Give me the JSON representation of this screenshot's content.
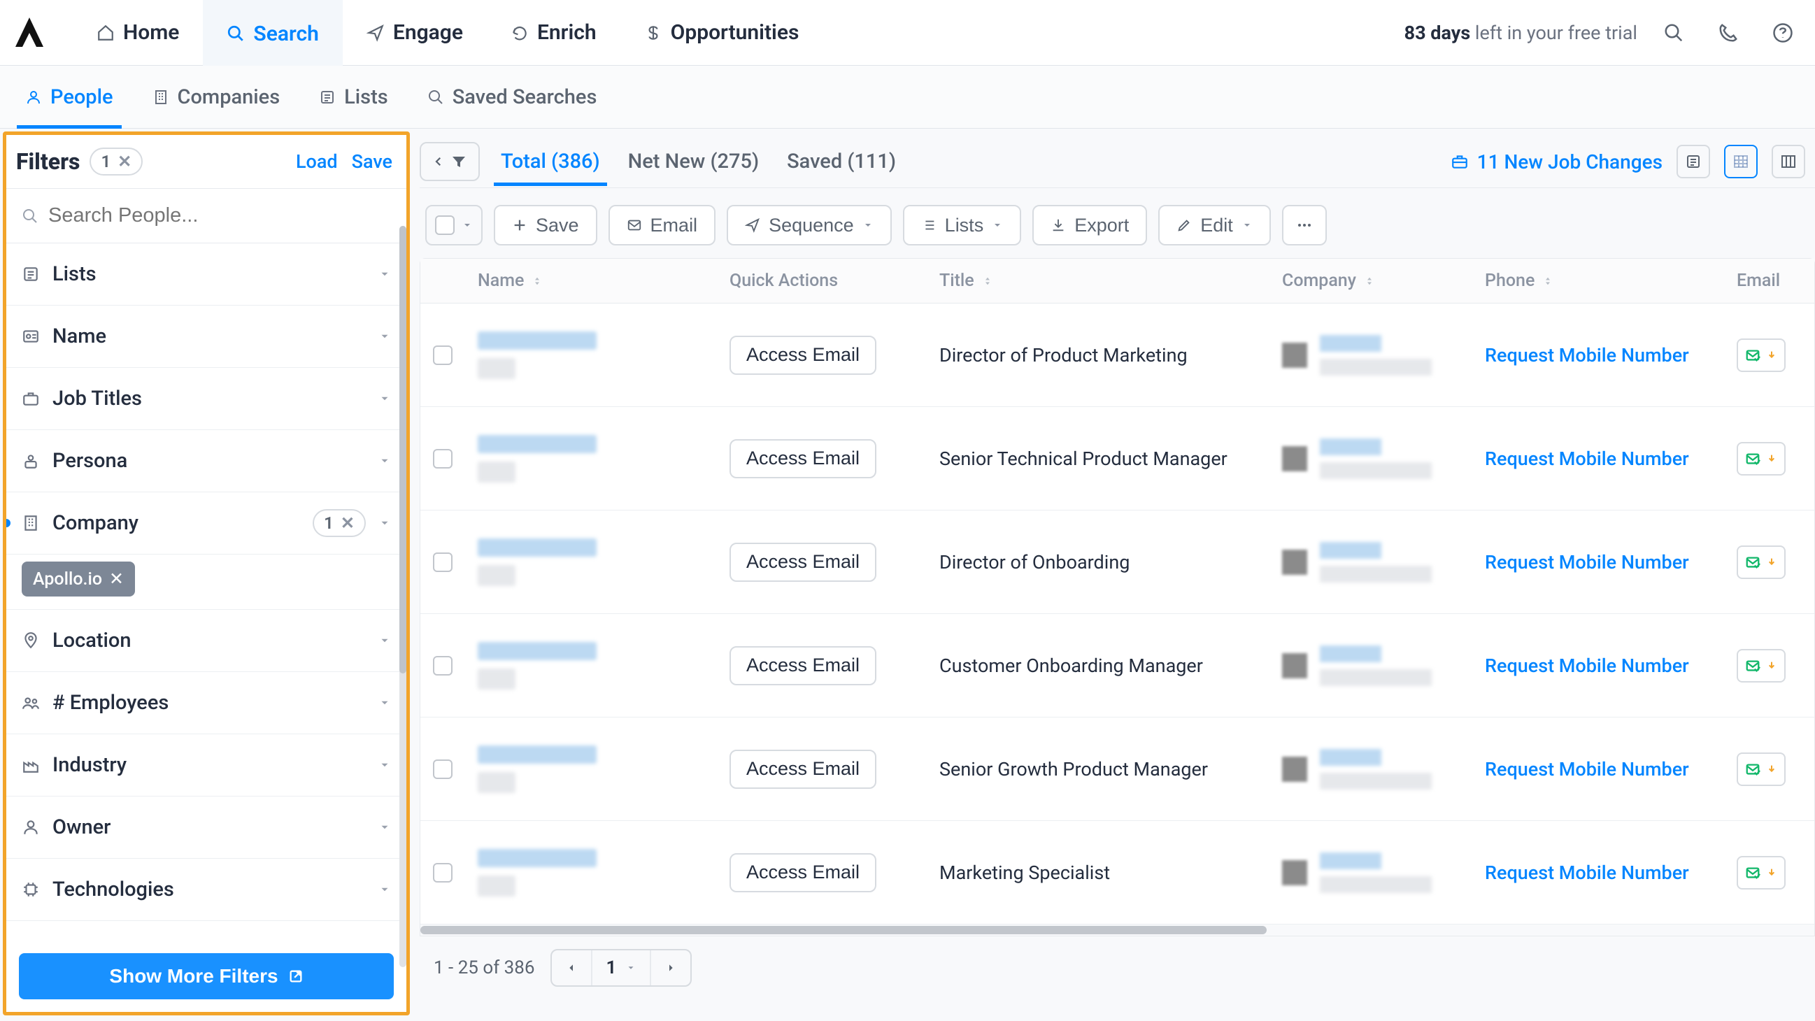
{
  "topnav": {
    "items": [
      {
        "label": "Home",
        "icon": "home"
      },
      {
        "label": "Search",
        "icon": "search",
        "active": true
      },
      {
        "label": "Engage",
        "icon": "send"
      },
      {
        "label": "Enrich",
        "icon": "refresh"
      },
      {
        "label": "Opportunities",
        "icon": "dollar"
      }
    ],
    "trial_days": "83 days",
    "trial_rest": " left in your free trial"
  },
  "subnav": {
    "items": [
      {
        "label": "People",
        "icon": "user",
        "active": true
      },
      {
        "label": "Companies",
        "icon": "building"
      },
      {
        "label": "Lists",
        "icon": "list"
      },
      {
        "label": "Saved Searches",
        "icon": "search"
      }
    ]
  },
  "filters": {
    "title": "Filters",
    "active_count": "1",
    "load_label": "Load",
    "save_label": "Save",
    "search_placeholder": "Search People...",
    "company_chip": "Apollo.io",
    "company_count": "1",
    "rows": [
      {
        "label": "Lists",
        "icon": "list"
      },
      {
        "label": "Name",
        "icon": "id"
      },
      {
        "label": "Job Titles",
        "icon": "briefcase"
      },
      {
        "label": "Persona",
        "icon": "persona"
      },
      {
        "label": "Company",
        "icon": "building",
        "has_count": true
      },
      {
        "label": "Location",
        "icon": "pin"
      },
      {
        "label": "# Employees",
        "icon": "people"
      },
      {
        "label": "Industry",
        "icon": "industry"
      },
      {
        "label": "Owner",
        "icon": "owner"
      },
      {
        "label": "Technologies",
        "icon": "tech"
      }
    ],
    "show_more_label": "Show More Filters"
  },
  "results": {
    "tabs": [
      {
        "label": "Total (386)",
        "active": true
      },
      {
        "label": "Net New (275)"
      },
      {
        "label": "Saved (111)"
      }
    ],
    "job_changes_label": "11 New Job Changes",
    "toolbar": {
      "save": "Save",
      "email": "Email",
      "sequence": "Sequence",
      "lists": "Lists",
      "export": "Export",
      "edit": "Edit"
    },
    "columns": {
      "name": "Name",
      "quick_actions": "Quick Actions",
      "title": "Title",
      "company": "Company",
      "phone": "Phone",
      "email": "Email"
    },
    "access_email_label": "Access Email",
    "request_phone_label": "Request Mobile Number",
    "rows": [
      {
        "title": "Director of Product Marketing"
      },
      {
        "title": "Senior Technical Product Manager"
      },
      {
        "title": "Director of Onboarding"
      },
      {
        "title": "Customer Onboarding Manager"
      },
      {
        "title": "Senior Growth Product Manager"
      },
      {
        "title": "Marketing Specialist"
      }
    ],
    "pager": {
      "range": "1 - 25 of 386",
      "page": "1"
    }
  }
}
